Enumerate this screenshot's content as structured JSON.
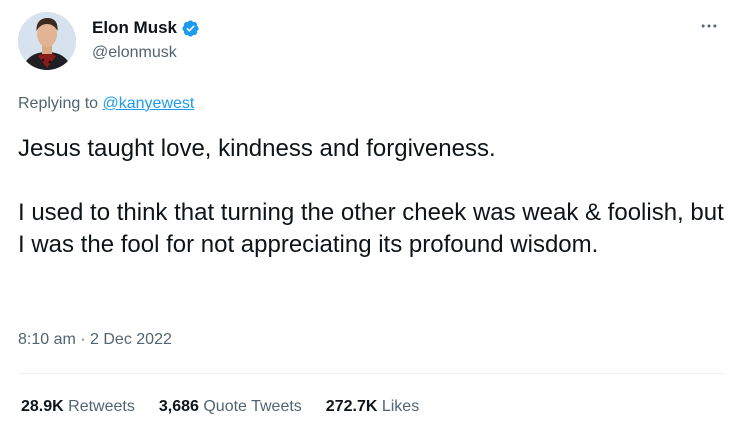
{
  "author": {
    "display_name": "Elon Musk",
    "handle": "@elonmusk",
    "verified": true,
    "verified_color": "#1d9bf0"
  },
  "reply": {
    "prefix": "Replying to ",
    "target": "@kanyewest"
  },
  "tweet": {
    "paragraphs": [
      "Jesus taught love, kindness and forgiveness.",
      "I used to think that turning the other cheek was weak & foolish, but I was the fool for not appreciating its profound wisdom."
    ],
    "timestamp": "8:10 am · 2 Dec 2022"
  },
  "stats": [
    {
      "count": "28.9K",
      "label": "Retweets"
    },
    {
      "count": "3,686",
      "label": "Quote Tweets"
    },
    {
      "count": "272.7K",
      "label": "Likes"
    }
  ],
  "icons": {
    "more": "more-horizontal-icon",
    "verified": "verified-badge-icon"
  },
  "colors": {
    "link": "#1d9bf0",
    "secondary_text": "#536471",
    "primary_text": "#0f1419"
  }
}
